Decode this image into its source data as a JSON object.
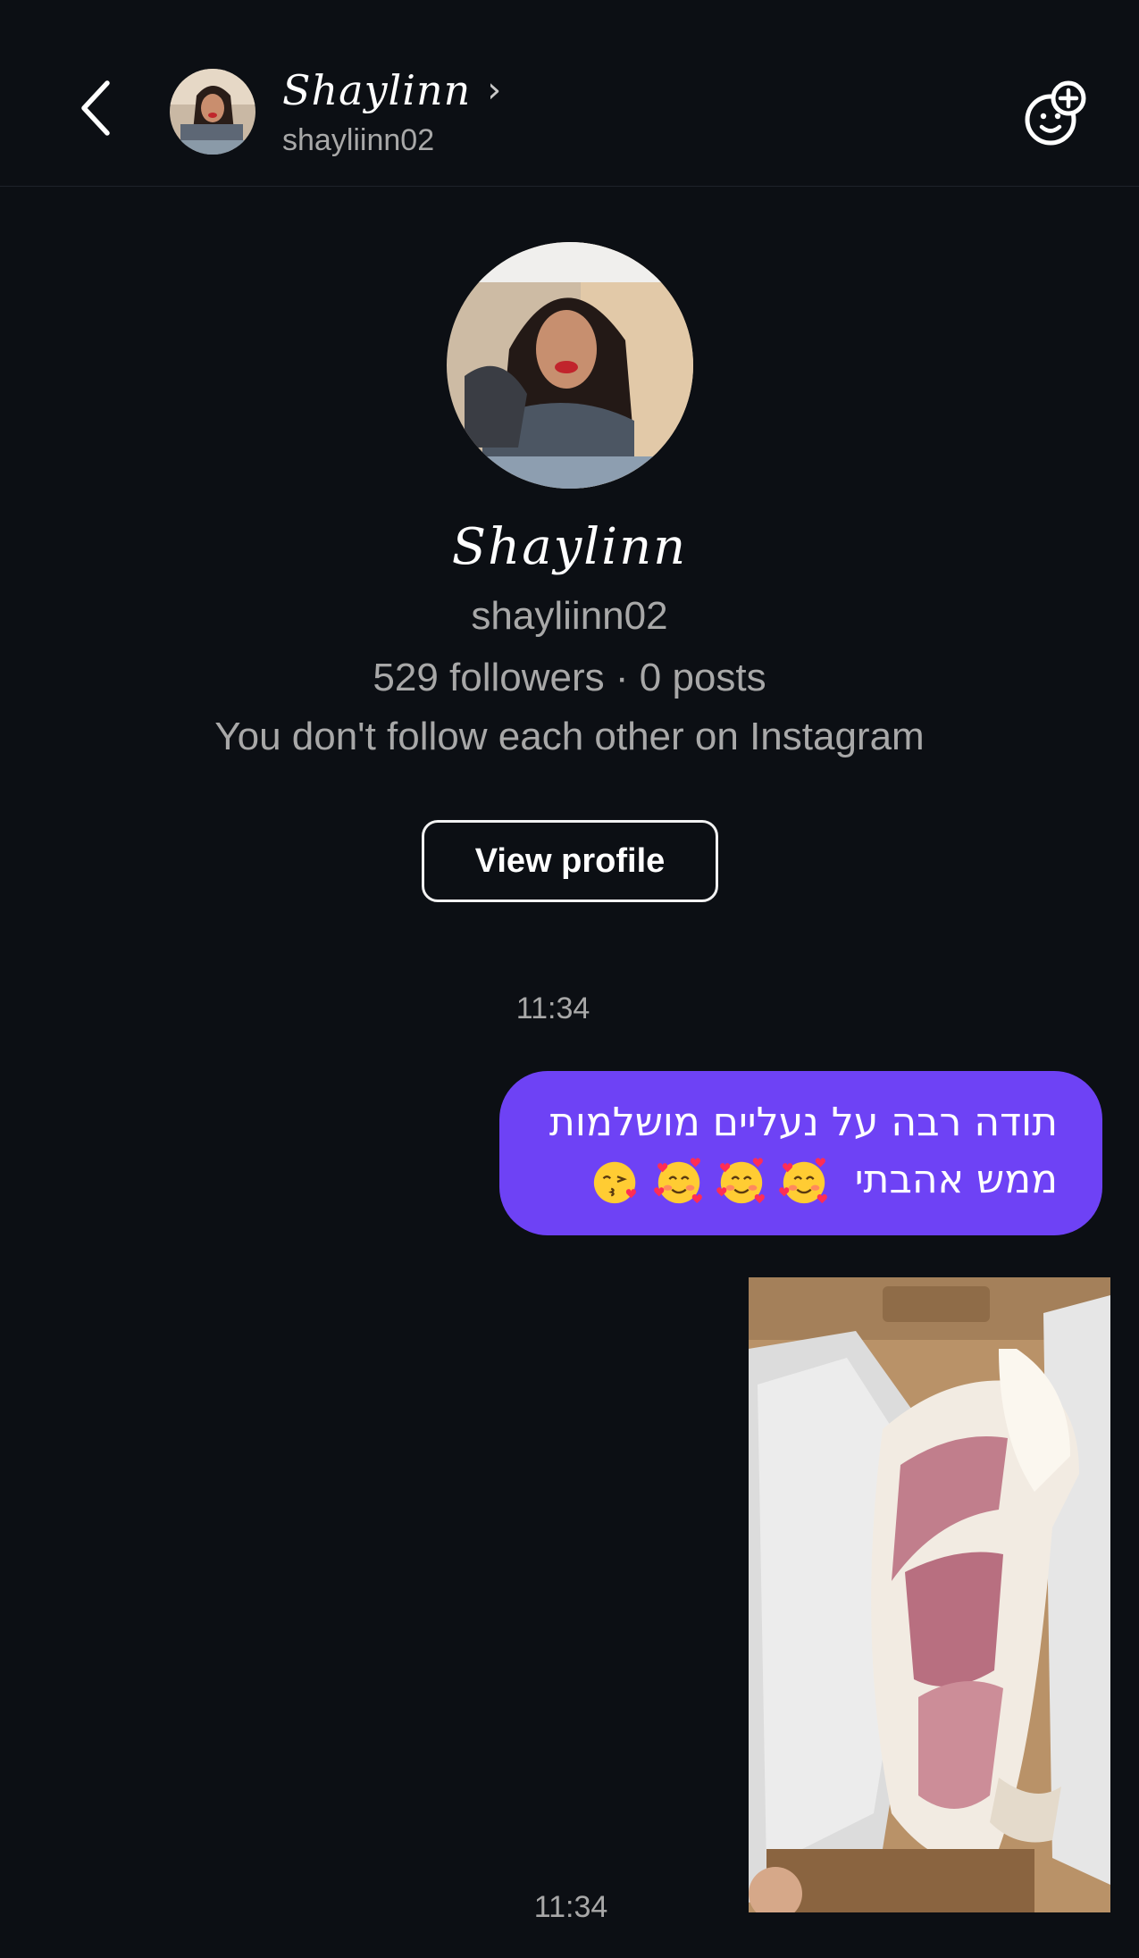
{
  "header": {
    "display_name": "Shaylinn",
    "chevron": "›",
    "username": "shayliinn02",
    "back_icon": "chevron-left-icon",
    "action_icon": "add-people-icon"
  },
  "profile": {
    "name": "Shaylinn",
    "username": "shayliinn02",
    "stats": "529 followers · 0 posts",
    "mutual_note": "You don't follow each other on Instagram",
    "view_profile_label": "View profile"
  },
  "messages": [
    {
      "timestamp": "11:34",
      "text_line1": "תודה רבה על נעליים מושלמות",
      "text_line2": "ממש אהבתי",
      "emojis": [
        "smiling-face-with-hearts",
        "smiling-face-with-hearts",
        "smiling-face-with-hearts",
        "face-blowing-a-kiss"
      ]
    },
    {
      "timestamp": "11:34",
      "type": "photo",
      "subject": "pink sneakers in box"
    }
  ],
  "colors": {
    "background": "#0c0f14",
    "bubble": "#6e42f5",
    "secondary_text": "#a8a8a8"
  }
}
